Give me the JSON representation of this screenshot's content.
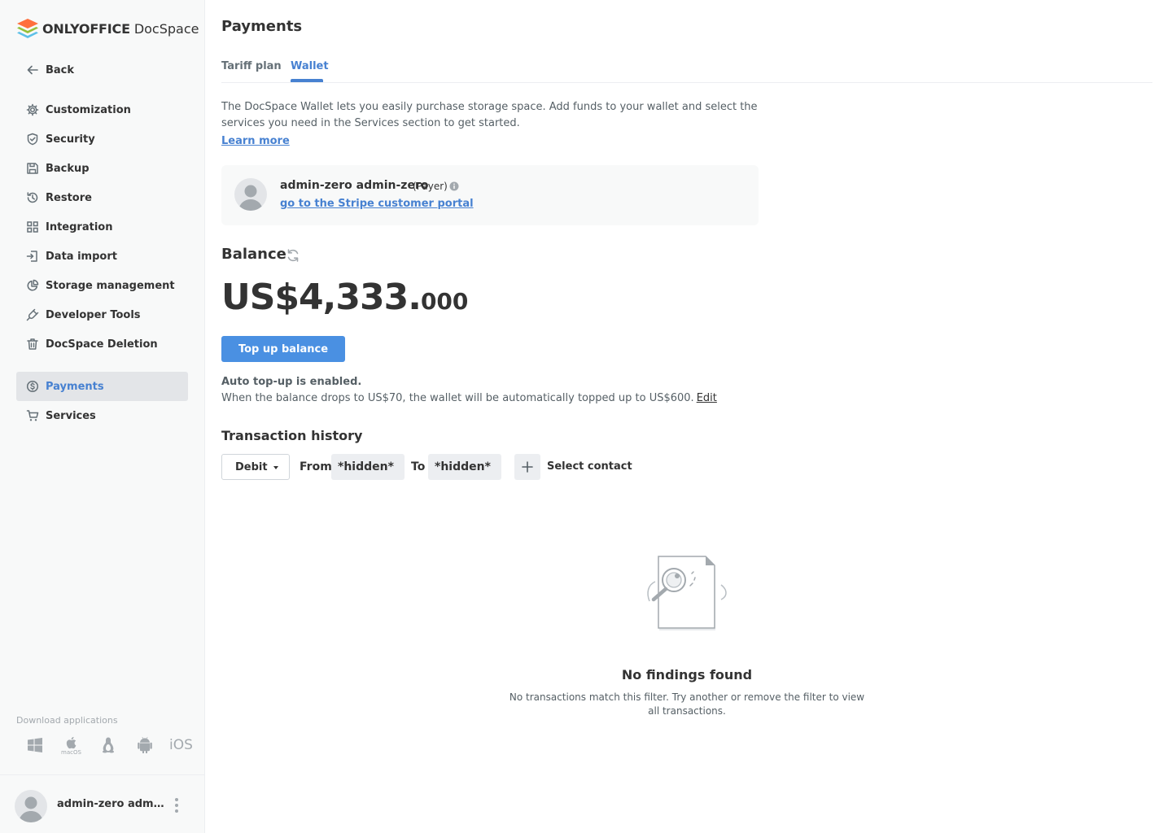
{
  "colors": {
    "accent": "#4781d1",
    "button": "#4a90e2",
    "sidebar_bg": "#f8f9f9",
    "active_item_bg": "#e3e5e8",
    "text": "#333333",
    "muted": "#a3a9ae"
  },
  "app": {
    "brand_bold": "ONLYOFFICE",
    "brand_light": "DocSpace"
  },
  "sidebar": {
    "back_label": "Back",
    "items": [
      {
        "label": "Customization",
        "icon": "gear-icon"
      },
      {
        "label": "Security",
        "icon": "shield-icon"
      },
      {
        "label": "Backup",
        "icon": "floppy-icon"
      },
      {
        "label": "Restore",
        "icon": "history-icon"
      },
      {
        "label": "Integration",
        "icon": "grid-icon"
      },
      {
        "label": "Data import",
        "icon": "import-icon"
      },
      {
        "label": "Storage management",
        "icon": "pie-chart-icon"
      },
      {
        "label": "Developer Tools",
        "icon": "plug-icon"
      },
      {
        "label": "DocSpace Deletion",
        "icon": "trash-icon"
      },
      {
        "label": "Payments",
        "icon": "dollar-icon",
        "active": true
      },
      {
        "label": "Services",
        "icon": "cart-icon"
      }
    ],
    "download_title": "Download applications",
    "download_apps": [
      "windows-icon",
      "macos-icon",
      "linux-icon",
      "android-icon",
      "ios-icon"
    ],
    "macos_label": "macOS",
    "ios_label": "iOS",
    "profile_name": "admin-zero admin-zero"
  },
  "main": {
    "title": "Payments",
    "tabs": [
      {
        "label": "Tariff plan",
        "active": false
      },
      {
        "label": "Wallet",
        "active": true
      }
    ],
    "description": "The DocSpace Wallet lets you easily purchase storage space. Add funds to your wallet and select the services you need in the Services section to get started.",
    "learn_more": "Learn more",
    "payer": {
      "name": "admin-zero admin-zero",
      "role": "(Payer)",
      "portal_link": "go to the Stripe customer portal"
    },
    "balance": {
      "title": "Balance",
      "amount_main": "US$4,333.",
      "amount_decimal": "000"
    },
    "topup_button": "Top up balance",
    "auto_topup": {
      "title": "Auto top-up is enabled.",
      "description": "When the balance drops to US$70, the wallet will be automatically topped up to US$600.",
      "edit": "Edit"
    },
    "transactions": {
      "title": "Transaction history",
      "type_selected": "Debit",
      "from_label": "From",
      "from_value": "*hidden*",
      "to_label": "To",
      "to_value": "*hidden*",
      "select_contact": "Select contact",
      "empty_title": "No findings found",
      "empty_description": "No transactions match this filter. Try another or remove the filter to view all transactions."
    }
  }
}
